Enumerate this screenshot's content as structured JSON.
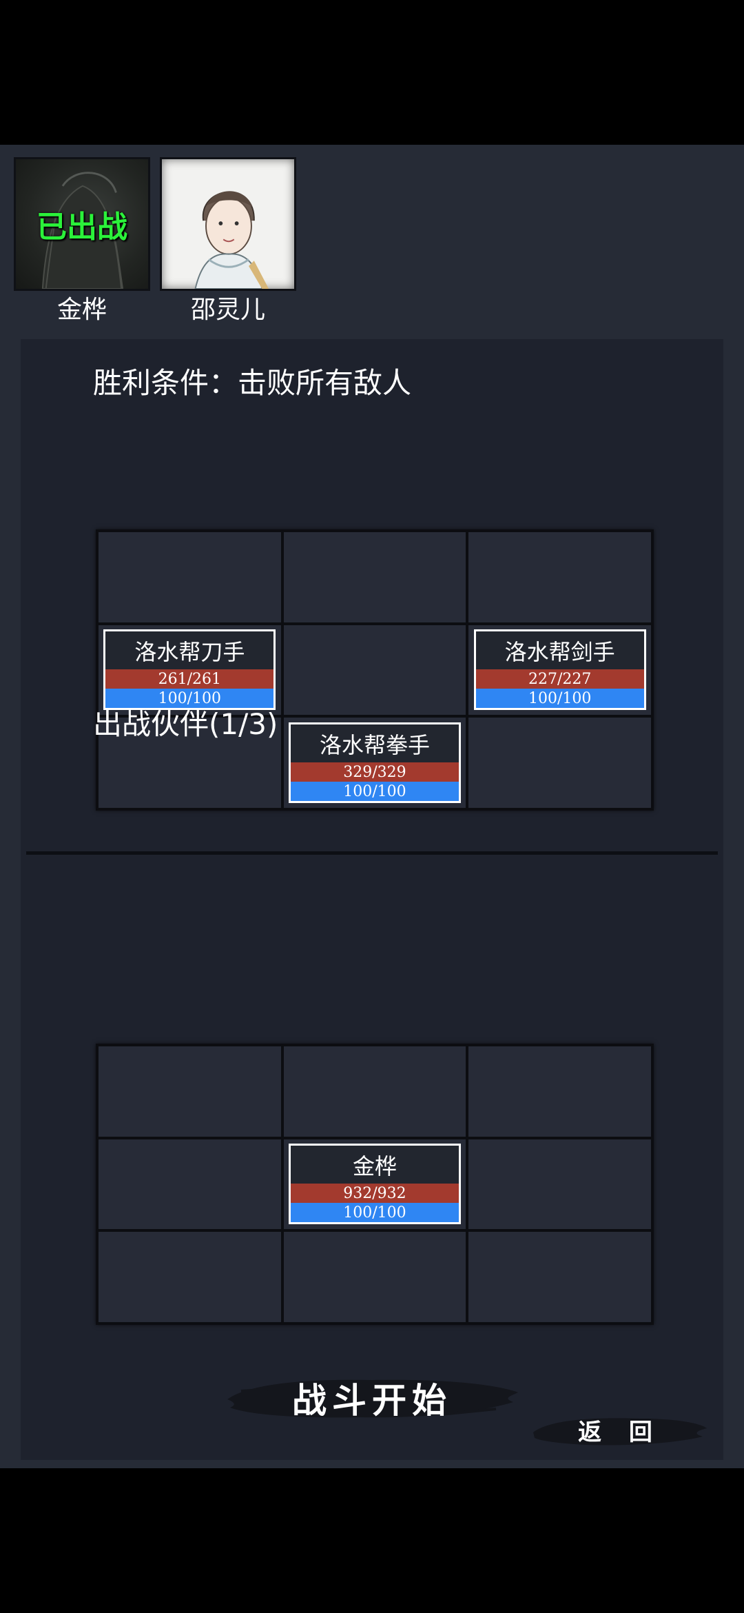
{
  "roster": [
    {
      "name": "金桦",
      "status": "已出战"
    },
    {
      "name": "邵灵儿",
      "status": ""
    }
  ],
  "enemy_section": {
    "title": "胜利条件：击败所有敌人",
    "units": [
      {
        "name": "洛水帮刀手",
        "hp": "261/261",
        "mp": "100/100"
      },
      {
        "name": "洛水帮剑手",
        "hp": "227/227",
        "mp": "100/100"
      },
      {
        "name": "洛水帮拳手",
        "hp": "329/329",
        "mp": "100/100"
      }
    ]
  },
  "ally_section": {
    "title": "出战伙伴(1/3)",
    "units": [
      {
        "name": "金桦",
        "hp": "932/932",
        "mp": "100/100"
      }
    ]
  },
  "buttons": {
    "start": "战斗开始",
    "back": "返 回"
  },
  "colors": {
    "background": "#262b36",
    "panel": "#1e222d",
    "hp_bar": "#a33a2e",
    "mp_bar": "#2f86f3",
    "deployed_text": "#2bf23a"
  }
}
